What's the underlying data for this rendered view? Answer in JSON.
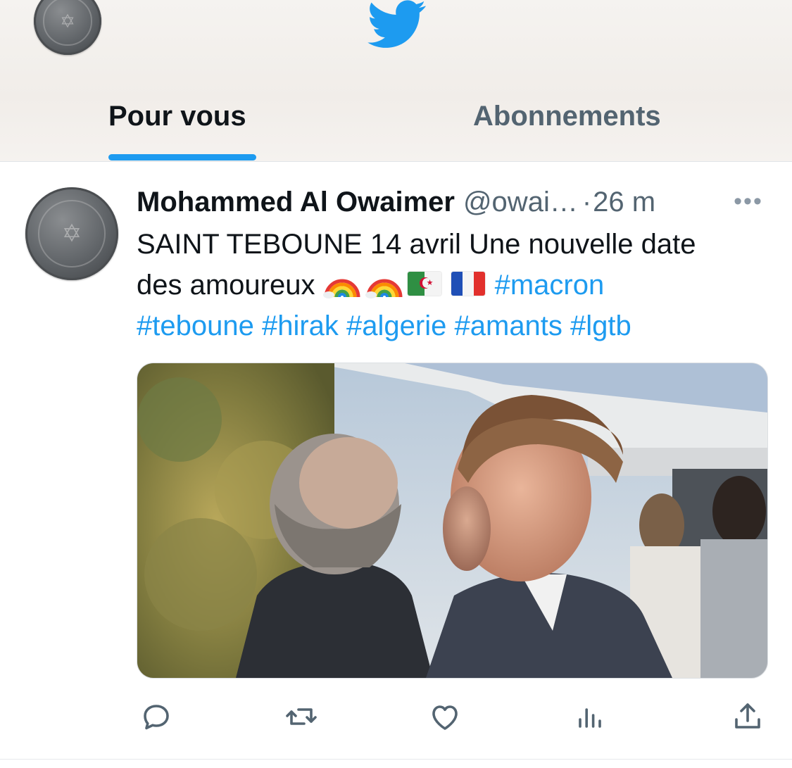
{
  "header": {
    "logo_icon": "twitter-bird-icon",
    "avatar_icon": "user-avatar",
    "tabs": [
      {
        "label": "Pour vous",
        "active": true
      },
      {
        "label": "Abonnements",
        "active": false
      }
    ]
  },
  "tweet": {
    "author_name": "Mohammed Al Owaimer",
    "handle": "@owai…",
    "separator": "·",
    "time": "26 m",
    "more_icon": "more-options-icon",
    "text_line1": "SAINT TEBOUNE 14 avril Une nouvelle date",
    "text_line2": "des amoureux",
    "emojis": [
      "rainbow-emoji",
      "rainbow-emoji",
      "algeria-flag-emoji",
      "france-flag-emoji"
    ],
    "hashtags": [
      "#macron",
      "#teboune",
      "#hirak",
      "#algerie",
      "#amants",
      "#lgtb"
    ],
    "actions": [
      {
        "icon": "reply-icon"
      },
      {
        "icon": "retweet-icon"
      },
      {
        "icon": "like-icon"
      },
      {
        "icon": "views-icon"
      },
      {
        "icon": "share-icon"
      }
    ]
  },
  "colors": {
    "accent": "#1d9bf0",
    "text_primary": "#0f1419",
    "text_secondary": "#536471"
  }
}
